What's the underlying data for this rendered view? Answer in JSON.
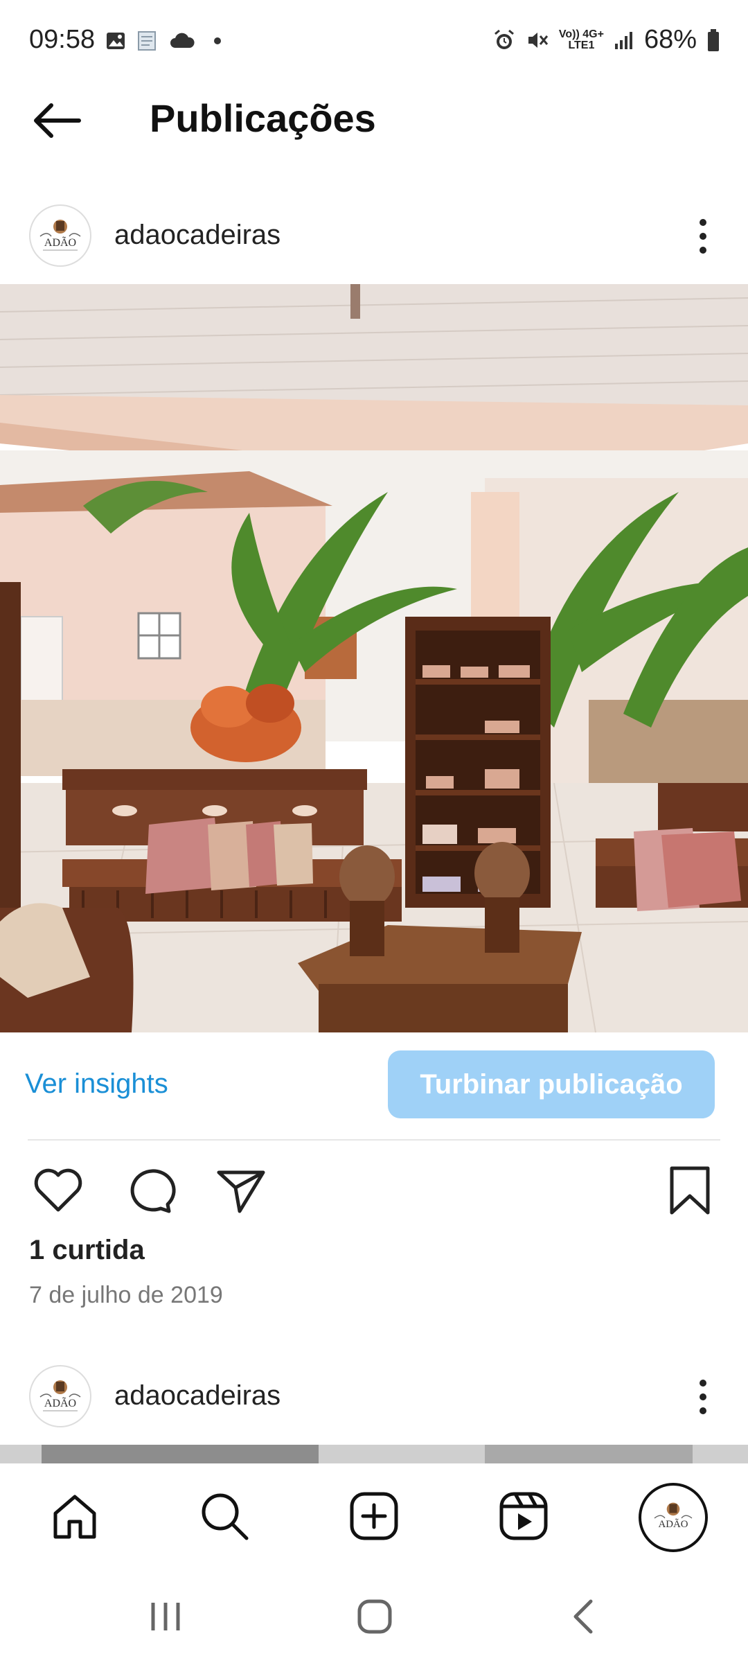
{
  "status_bar": {
    "time": "09:58",
    "battery": "68%",
    "net_top": "Vo)) 4G+",
    "net_bottom": "LTE1",
    "icons": [
      "image-icon",
      "notes-icon",
      "cloud-icon",
      "dot-icon",
      "alarm-icon",
      "mute-icon",
      "signal-icon",
      "battery-icon"
    ]
  },
  "header": {
    "title": "Publicações"
  },
  "post": {
    "username": "adaocadeiras",
    "avatar_text": "ADÃO",
    "insights_label": "Ver insights",
    "boost_label": "Turbinar publicação",
    "likes": "1 curtida",
    "date": "7 de julho de 2019"
  },
  "post2": {
    "username": "adaocadeiras",
    "avatar_text": "ADÃO"
  },
  "colors": {
    "accent_link": "#1a8fd6",
    "boost_button": "#9fd1f7"
  },
  "bottom_nav": {
    "items": [
      "home-icon",
      "search-icon",
      "create-icon",
      "reels-icon",
      "profile-avatar"
    ]
  }
}
